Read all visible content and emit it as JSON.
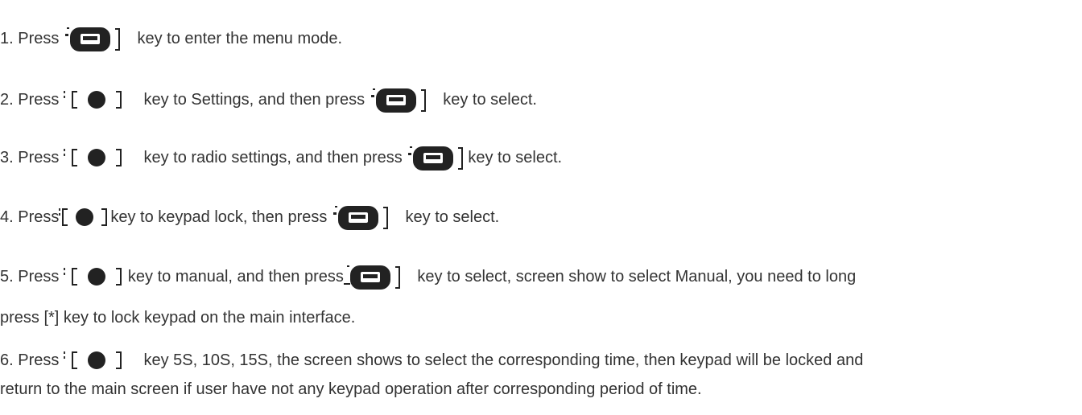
{
  "instructions": {
    "step1": {
      "prefix": "1. Press ",
      "suffix": " key to enter the menu mode.",
      "key_icon": "menu-key-icon"
    },
    "step2": {
      "prefix": "2. Press ",
      "middle": " key to Settings, and then press ",
      "suffix": " key to select.",
      "key_icons": [
        "navigation-key-icon",
        "menu-key-icon"
      ]
    },
    "step3": {
      "prefix": "3. Press ",
      "middle": " key to radio settings, and then press ",
      "suffix": "key to select.",
      "key_icons": [
        "navigation-key-icon",
        "menu-key-icon"
      ]
    },
    "step4": {
      "prefix": "4. Press",
      "middle": "key to keypad lock, then press ",
      "suffix": " key to select.",
      "key_icons": [
        "navigation-key-icon",
        "menu-key-icon"
      ]
    },
    "step5": {
      "prefix": "5. Press ",
      "middle": "key to manual, and then press",
      "suffix": " key to select, screen show to select Manual, you need to long",
      "continuation": "press [*] key to lock keypad on the main interface.",
      "key_icons": [
        "navigation-key-icon",
        "menu-key-icon"
      ]
    },
    "step6": {
      "prefix": "6. Press ",
      "suffix": " key 5S, 10S, 15S, the screen shows to select the corresponding time, then keypad will be locked and",
      "continuation": "return to the main screen if user have not any keypad operation after corresponding period of time.",
      "key_icon": "navigation-key-icon"
    }
  },
  "colors": {
    "text": "#333333",
    "icon": "#222222"
  }
}
